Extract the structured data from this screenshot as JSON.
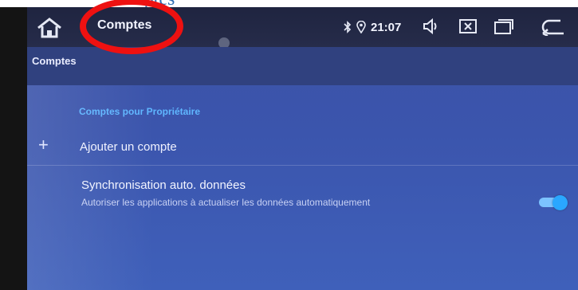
{
  "caption": "omptes",
  "statusbar": {
    "title": "Comptes",
    "time": "21:07",
    "icons": [
      "home-icon",
      "bluetooth-icon",
      "location-icon",
      "volume-icon",
      "close-app-icon",
      "recent-apps-icon",
      "back-icon"
    ]
  },
  "page": {
    "header_title": "Comptes",
    "section_title": "Comptes pour Propriétaire",
    "add_account_label": "Ajouter un compte",
    "sync": {
      "title": "Synchronisation auto. données",
      "subtitle": "Autoriser les applications à actualiser les données automatiquement",
      "enabled": true
    }
  },
  "colors": {
    "accent": "#5fb6ff",
    "toggle_on": "#2aa7ff",
    "annotation_red": "#ee1111"
  }
}
